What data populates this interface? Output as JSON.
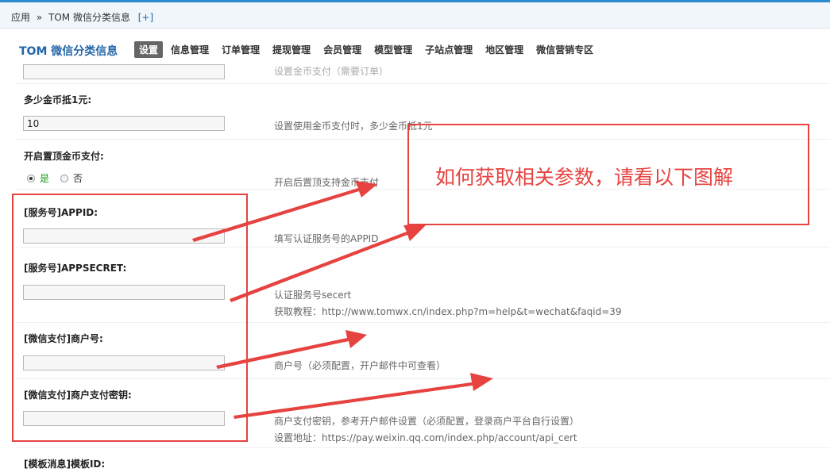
{
  "breadcrumb": {
    "root": "应用",
    "separator": "»",
    "current": "TOM 微信分类信息",
    "add": "[+]"
  },
  "nav": {
    "brand": "TOM 微信分类信息",
    "tabs": [
      "设置",
      "信息管理",
      "订单管理",
      "提现管理",
      "会员管理",
      "模型管理",
      "子站点管理",
      "地区管理",
      "微信营销专区"
    ],
    "active_tab": "设置"
  },
  "form": {
    "top_partial_desc": "设置金币支付（需要订单）",
    "coin_rate": {
      "label": "多少金币抵1元:",
      "value": "10",
      "desc": "设置使用金币支付时，多少金币抵1元"
    },
    "top_pay": {
      "label": "开启置顶金币支付:",
      "yes": "是",
      "no": "否",
      "selected": "是",
      "desc": "开启后置顶支持金币支付"
    },
    "appid": {
      "label": "[服务号]APPID:",
      "value": "",
      "desc": "填写认证服务号的APPID"
    },
    "appsecret": {
      "label": "[服务号]APPSECRET:",
      "value": "",
      "desc": "认证服务号secert",
      "desc2": "获取教程：http://www.tomwx.cn/index.php?m=help&t=wechat&faqid=39"
    },
    "mchid": {
      "label": "[微信支付]商户号:",
      "value": "",
      "desc": "商户号（必须配置，开户邮件中可查看）"
    },
    "mchkey": {
      "label": "[微信支付]商户支付密钥:",
      "value": "",
      "desc": "商户支付密钥，参考开户邮件设置（必须配置，登录商户平台自行设置）",
      "desc2": "设置地址：https://pay.weixin.qq.com/index.php/account/api_cert"
    },
    "template": {
      "label": "[模板消息]模板ID:"
    }
  },
  "annotation": {
    "text": "如何获取相关参数，请看以下图解",
    "color": "#e64340"
  },
  "colors": {
    "accent": "#2366a8",
    "top_border": "#2a8bd0",
    "annotation_red": "#e64340"
  }
}
